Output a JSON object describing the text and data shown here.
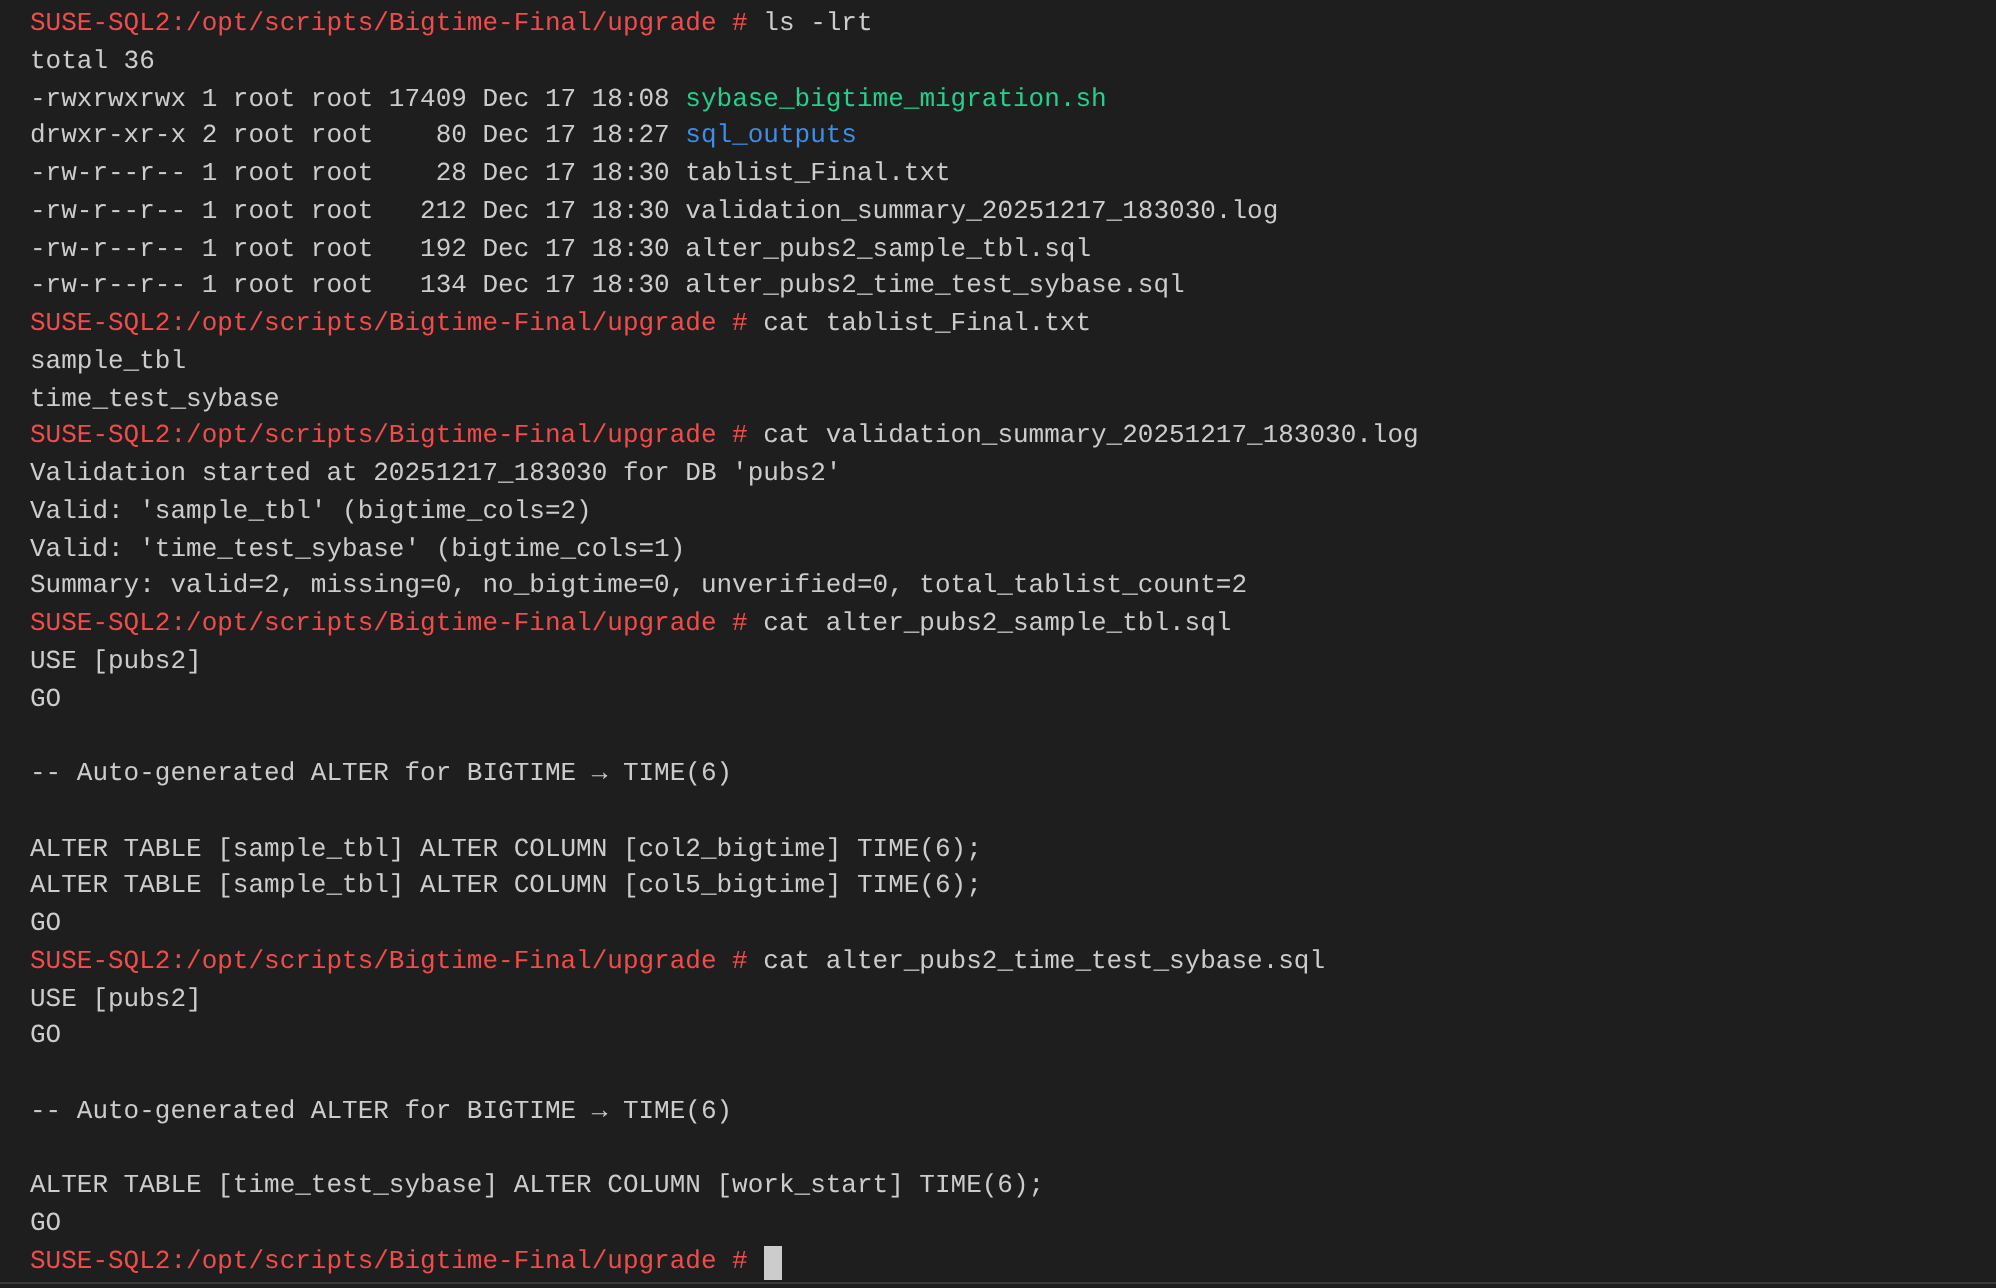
{
  "terminal": {
    "lines": [
      {
        "kind": "prompt",
        "prompt": "SUSE-SQL2:/opt/scripts/Bigtime-Final/upgrade #",
        "command": "ls -lrt"
      },
      {
        "kind": "text",
        "text": "total 36"
      },
      {
        "kind": "listing",
        "info": "-rwxrwxrwx 1 root root 17409 Dec 17 18:08",
        "name": "sybase_bigtime_migration.sh",
        "color": "#23d18b"
      },
      {
        "kind": "listing",
        "info": "drwxr-xr-x 2 root root    80 Dec 17 18:27",
        "name": "sql_outputs",
        "color": "#3b8eea"
      },
      {
        "kind": "listing",
        "info": "-rw-r--r-- 1 root root    28 Dec 17 18:30",
        "name": "tablist_Final.txt",
        "color": "#cccccc"
      },
      {
        "kind": "listing",
        "info": "-rw-r--r-- 1 root root   212 Dec 17 18:30",
        "name": "validation_summary_20251217_183030.log",
        "color": "#cccccc"
      },
      {
        "kind": "listing",
        "info": "-rw-r--r-- 1 root root   192 Dec 17 18:30",
        "name": "alter_pubs2_sample_tbl.sql",
        "color": "#cccccc"
      },
      {
        "kind": "listing",
        "info": "-rw-r--r-- 1 root root   134 Dec 17 18:30",
        "name": "alter_pubs2_time_test_sybase.sql",
        "color": "#cccccc"
      },
      {
        "kind": "prompt",
        "prompt": "SUSE-SQL2:/opt/scripts/Bigtime-Final/upgrade #",
        "command": "cat tablist_Final.txt"
      },
      {
        "kind": "text",
        "text": "sample_tbl"
      },
      {
        "kind": "text",
        "text": "time_test_sybase"
      },
      {
        "kind": "prompt",
        "prompt": "SUSE-SQL2:/opt/scripts/Bigtime-Final/upgrade #",
        "command": "cat validation_summary_20251217_183030.log"
      },
      {
        "kind": "text",
        "text": "Validation started at 20251217_183030 for DB 'pubs2'"
      },
      {
        "kind": "text",
        "text": "Valid: 'sample_tbl' (bigtime_cols=2)"
      },
      {
        "kind": "text",
        "text": "Valid: 'time_test_sybase' (bigtime_cols=1)"
      },
      {
        "kind": "text",
        "text": "Summary: valid=2, missing=0, no_bigtime=0, unverified=0, total_tablist_count=2"
      },
      {
        "kind": "prompt",
        "prompt": "SUSE-SQL2:/opt/scripts/Bigtime-Final/upgrade #",
        "command": "cat alter_pubs2_sample_tbl.sql"
      },
      {
        "kind": "text",
        "text": "USE [pubs2]"
      },
      {
        "kind": "text",
        "text": "GO"
      },
      {
        "kind": "blank"
      },
      {
        "kind": "text",
        "text": "-- Auto-generated ALTER for BIGTIME → TIME(6)"
      },
      {
        "kind": "blank"
      },
      {
        "kind": "text",
        "text": "ALTER TABLE [sample_tbl] ALTER COLUMN [col2_bigtime] TIME(6);"
      },
      {
        "kind": "text",
        "text": "ALTER TABLE [sample_tbl] ALTER COLUMN [col5_bigtime] TIME(6);"
      },
      {
        "kind": "text",
        "text": "GO"
      },
      {
        "kind": "prompt",
        "prompt": "SUSE-SQL2:/opt/scripts/Bigtime-Final/upgrade #",
        "command": "cat alter_pubs2_time_test_sybase.sql"
      },
      {
        "kind": "text",
        "text": "USE [pubs2]"
      },
      {
        "kind": "text",
        "text": "GO"
      },
      {
        "kind": "blank"
      },
      {
        "kind": "text",
        "text": "-- Auto-generated ALTER for BIGTIME → TIME(6)"
      },
      {
        "kind": "blank"
      },
      {
        "kind": "text",
        "text": "ALTER TABLE [time_test_sybase] ALTER COLUMN [work_start] TIME(6);"
      },
      {
        "kind": "text",
        "text": "GO"
      },
      {
        "kind": "prompt",
        "prompt": "SUSE-SQL2:/opt/scripts/Bigtime-Final/upgrade #",
        "cursor": true
      }
    ]
  }
}
